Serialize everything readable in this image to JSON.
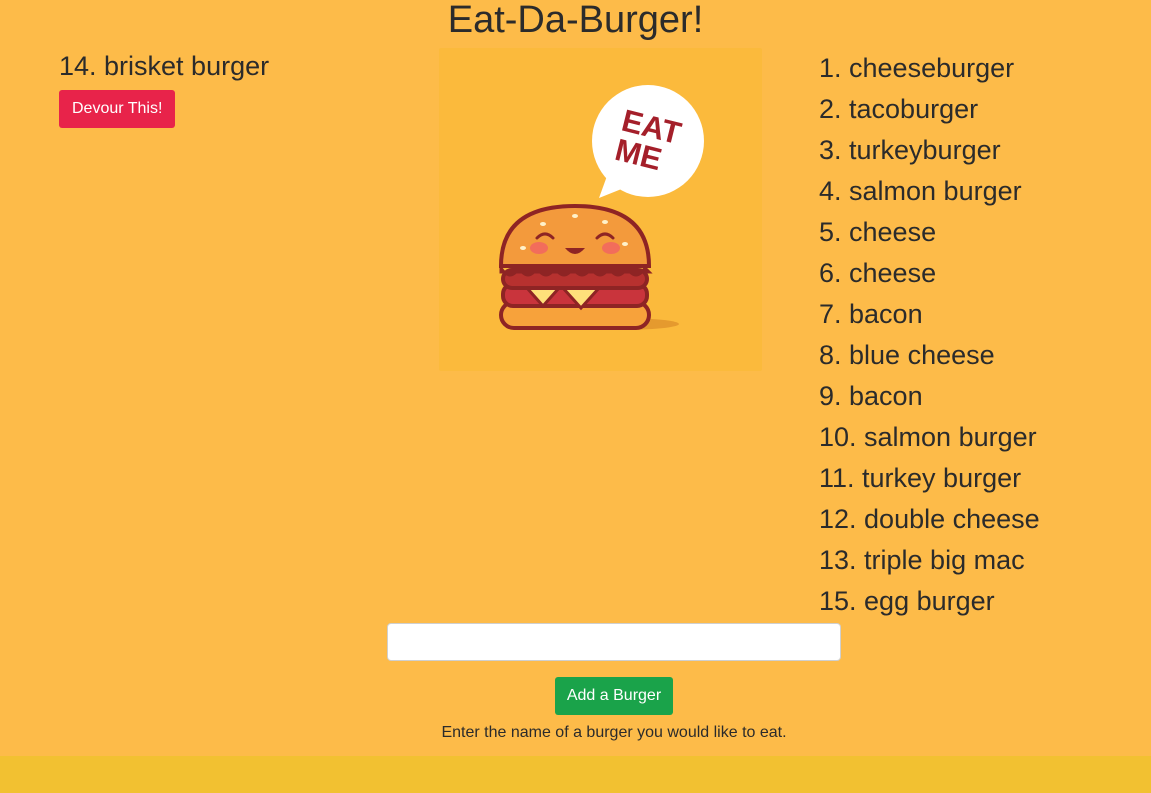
{
  "header": {
    "title": "Eat-Da-Burger!"
  },
  "uneaten": [
    {
      "label": "14. brisket burger",
      "button_label": "Devour This!"
    }
  ],
  "illustration": {
    "speech_text_line1": "EAT",
    "speech_text_line2": "ME",
    "icon": "burger-mascot-icon"
  },
  "eaten": [
    "1. cheeseburger",
    "2. tacoburger",
    "3. turkeyburger",
    "4. salmon burger",
    "5. cheese",
    "6. cheese",
    "7. bacon",
    "8. blue cheese",
    "9. bacon",
    "10. salmon burger",
    "11. turkey burger",
    "12. double cheese",
    "13. triple big mac",
    "15. egg burger"
  ],
  "form": {
    "input_value": "",
    "input_placeholder": "",
    "submit_label": "Add a Burger",
    "hint": "Enter the name of a burger you would like to eat."
  },
  "colors": {
    "background": "#fdbb49",
    "devour_button": "#e8234a",
    "add_button": "#1aa34a",
    "footer": "#f2c131"
  }
}
